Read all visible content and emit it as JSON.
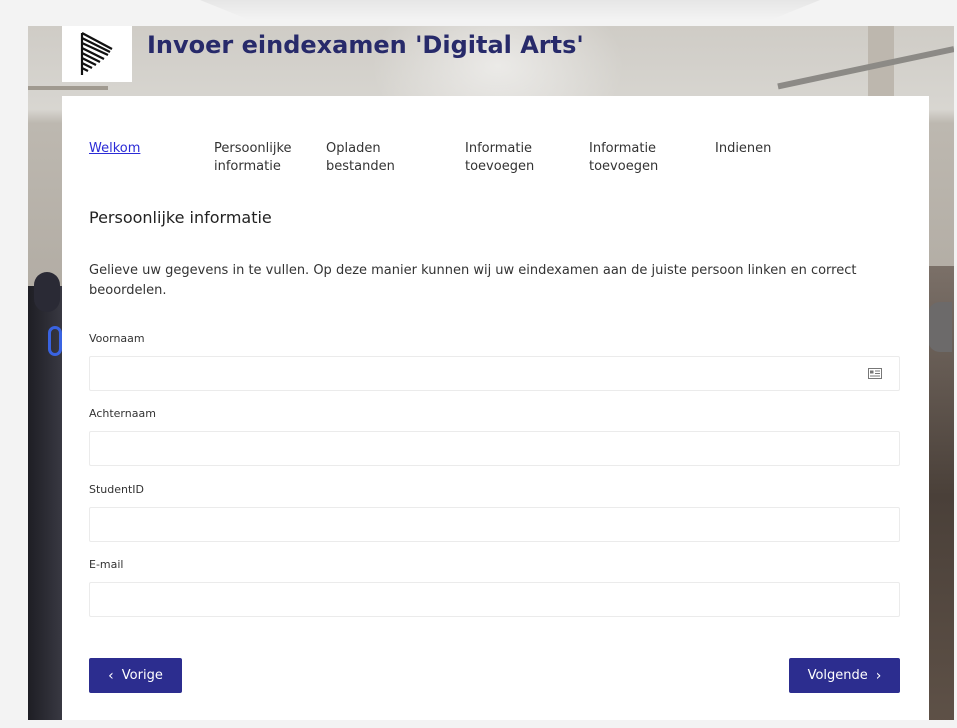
{
  "header": {
    "title": "Invoer eindexamen 'Digital Arts'",
    "logo_icon": "striped-triangle-logo"
  },
  "steps": [
    {
      "label": "Welkom",
      "active": true
    },
    {
      "label": "Persoonlijke informatie",
      "active": false
    },
    {
      "label": "Opladen bestanden",
      "active": false
    },
    {
      "label": "Informatie toevoegen",
      "active": false
    },
    {
      "label": "Informatie toevoegen",
      "active": false
    },
    {
      "label": "Indienen",
      "active": false
    }
  ],
  "section": {
    "heading": "Persoonlijke informatie",
    "intro": "Gelieve uw gegevens in te vullen. Op deze manier kunnen wij uw eindexamen aan de juiste persoon linken en correct beoordelen."
  },
  "form": {
    "fields": [
      {
        "label": "Voornaam",
        "value": "",
        "icon": "contact-card-icon"
      },
      {
        "label": "Achternaam",
        "value": ""
      },
      {
        "label": "StudentID",
        "value": ""
      },
      {
        "label": "E-mail",
        "value": ""
      }
    ]
  },
  "nav": {
    "prev_label": "Vorige",
    "next_label": "Volgende",
    "prev_icon": "‹",
    "next_icon": "›"
  },
  "colors": {
    "brand": "#272a6a",
    "button": "#2c2d8f",
    "link": "#2b2bd6"
  }
}
